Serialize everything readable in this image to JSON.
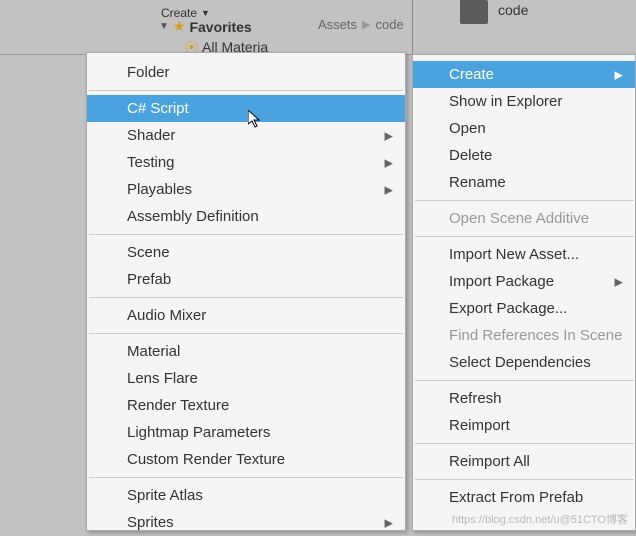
{
  "topbar": {
    "create_btn": "Create",
    "favorites_label": "Favorites",
    "all_materials": "All Materia",
    "breadcrumb_root": "Assets",
    "breadcrumb_current": "code",
    "folder_name": "code"
  },
  "submenu": {
    "items": [
      {
        "label": "Folder",
        "arrow": false
      },
      {
        "sep": true
      },
      {
        "label": "C# Script",
        "arrow": false,
        "highlighted": true
      },
      {
        "label": "Shader",
        "arrow": true
      },
      {
        "label": "Testing",
        "arrow": true
      },
      {
        "label": "Playables",
        "arrow": true
      },
      {
        "label": "Assembly Definition",
        "arrow": false
      },
      {
        "sep": true
      },
      {
        "label": "Scene",
        "arrow": false
      },
      {
        "label": "Prefab",
        "arrow": false
      },
      {
        "sep": true
      },
      {
        "label": "Audio Mixer",
        "arrow": false
      },
      {
        "sep": true
      },
      {
        "label": "Material",
        "arrow": false
      },
      {
        "label": "Lens Flare",
        "arrow": false
      },
      {
        "label": "Render Texture",
        "arrow": false
      },
      {
        "label": "Lightmap Parameters",
        "arrow": false
      },
      {
        "label": "Custom Render Texture",
        "arrow": false
      },
      {
        "sep": true
      },
      {
        "label": "Sprite Atlas",
        "arrow": false
      },
      {
        "label": "Sprites",
        "arrow": true
      }
    ]
  },
  "main_menu": {
    "items": [
      {
        "label": "Create",
        "arrow": true,
        "highlighted": true
      },
      {
        "label": "Show in Explorer"
      },
      {
        "label": "Open"
      },
      {
        "label": "Delete"
      },
      {
        "label": "Rename"
      },
      {
        "sep": true
      },
      {
        "label": "Open Scene Additive",
        "disabled": true
      },
      {
        "sep": true
      },
      {
        "label": "Import New Asset..."
      },
      {
        "label": "Import Package",
        "arrow": true
      },
      {
        "label": "Export Package..."
      },
      {
        "label": "Find References In Scene",
        "disabled": true
      },
      {
        "label": "Select Dependencies"
      },
      {
        "sep": true
      },
      {
        "label": "Refresh"
      },
      {
        "label": "Reimport"
      },
      {
        "sep": true
      },
      {
        "label": "Reimport All"
      },
      {
        "sep": true
      },
      {
        "label": "Extract From Prefab"
      }
    ]
  },
  "watermark": "https://blog.csdn.net/u@51CTO博客"
}
